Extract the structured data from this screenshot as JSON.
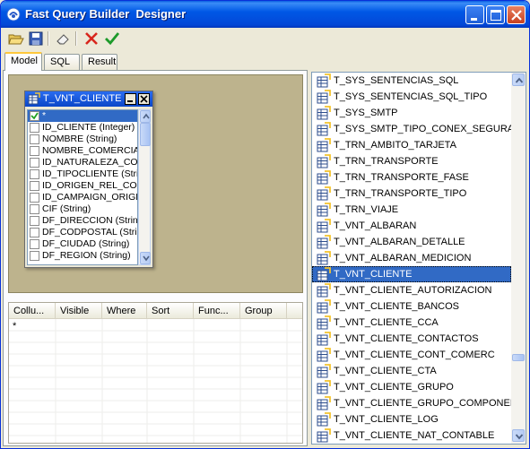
{
  "window": {
    "title": "Fast Query Builder  Designer"
  },
  "tabs": [
    {
      "label": "Model",
      "active": true
    },
    {
      "label": "SQL",
      "active": false
    },
    {
      "label": "Result",
      "active": false
    }
  ],
  "table_window": {
    "title": "T_VNT_CLIENTE",
    "fields": [
      {
        "label": "*",
        "checked": true
      },
      {
        "label": "ID_CLIENTE (Integer)",
        "checked": false
      },
      {
        "label": "NOMBRE (String)",
        "checked": false
      },
      {
        "label": "NOMBRE_COMERCIAL",
        "checked": false
      },
      {
        "label": "ID_NATURALEZA_COI",
        "checked": false
      },
      {
        "label": "ID_TIPOCLIENTE (Stri",
        "checked": false
      },
      {
        "label": "ID_ORIGEN_REL_CON",
        "checked": false
      },
      {
        "label": "ID_CAMPAIGN_ORIGE",
        "checked": false
      },
      {
        "label": "CIF (String)",
        "checked": false
      },
      {
        "label": "DF_DIRECCION (Strin",
        "checked": false
      },
      {
        "label": "DF_CODPOSTAL (Strin",
        "checked": false
      },
      {
        "label": "DF_CIUDAD (String)",
        "checked": false
      },
      {
        "label": "DF_REGION (String)",
        "checked": false
      }
    ]
  },
  "grid": {
    "columns": [
      "Collu...",
      "Visible",
      "Where",
      "Sort",
      "Func...",
      "Group"
    ],
    "rows": [
      [
        "*",
        "",
        "",
        "",
        "",
        ""
      ]
    ]
  },
  "table_list": {
    "items": [
      "T_SYS_SENTENCIAS_SQL",
      "T_SYS_SENTENCIAS_SQL_TIPO",
      "T_SYS_SMTP",
      "T_SYS_SMTP_TIPO_CONEX_SEGURA",
      "T_TRN_AMBITO_TARJETA",
      "T_TRN_TRANSPORTE",
      "T_TRN_TRANSPORTE_FASE",
      "T_TRN_TRANSPORTE_TIPO",
      "T_TRN_VIAJE",
      "T_VNT_ALBARAN",
      "T_VNT_ALBARAN_DETALLE",
      "T_VNT_ALBARAN_MEDICION",
      "T_VNT_CLIENTE",
      "T_VNT_CLIENTE_AUTORIZACION",
      "T_VNT_CLIENTE_BANCOS",
      "T_VNT_CLIENTE_CCA",
      "T_VNT_CLIENTE_CONTACTOS",
      "T_VNT_CLIENTE_CONT_COMERC",
      "T_VNT_CLIENTE_CTA",
      "T_VNT_CLIENTE_GRUPO",
      "T_VNT_CLIENTE_GRUPO_COMPONENTE",
      "T_VNT_CLIENTE_LOG",
      "T_VNT_CLIENTE_NAT_CONTABLE"
    ],
    "selected": "T_VNT_CLIENTE"
  },
  "icons": {
    "app": "app-icon",
    "open": "open-folder-icon",
    "save": "save-disk-icon",
    "clear": "eraser-icon",
    "cancel": "red-x-icon",
    "ok": "green-check-icon",
    "table": "table-icon"
  },
  "colors": {
    "titlebar": "#0058e6",
    "selection": "#316ac5",
    "design_area": "#bdb38d",
    "active_tab_accent": "#ffc83c"
  }
}
